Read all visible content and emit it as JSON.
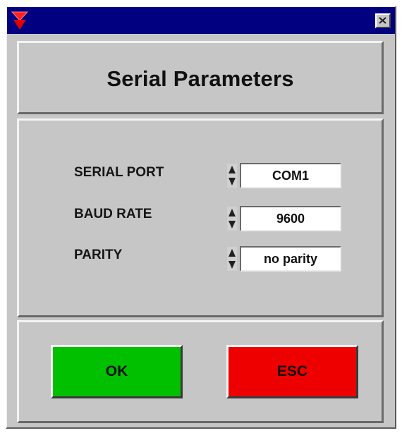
{
  "window": {
    "titlebar_color": "#000080",
    "logo_icon": "red-triangle-logo-icon",
    "close_icon": "close-icon"
  },
  "dialog": {
    "title": "Serial Parameters"
  },
  "params": [
    {
      "label": "SERIAL PORT",
      "value": "COM1",
      "spinner_icon": "up-down-spinner-icon"
    },
    {
      "label": "BAUD RATE",
      "value": "9600",
      "spinner_icon": "up-down-spinner-icon"
    },
    {
      "label": "PARITY",
      "value": "no parity",
      "spinner_icon": "up-down-spinner-icon"
    }
  ],
  "buttons": {
    "ok_label": "OK",
    "ok_color": "#00c000",
    "esc_label": "ESC",
    "esc_color": "#ee0000"
  }
}
